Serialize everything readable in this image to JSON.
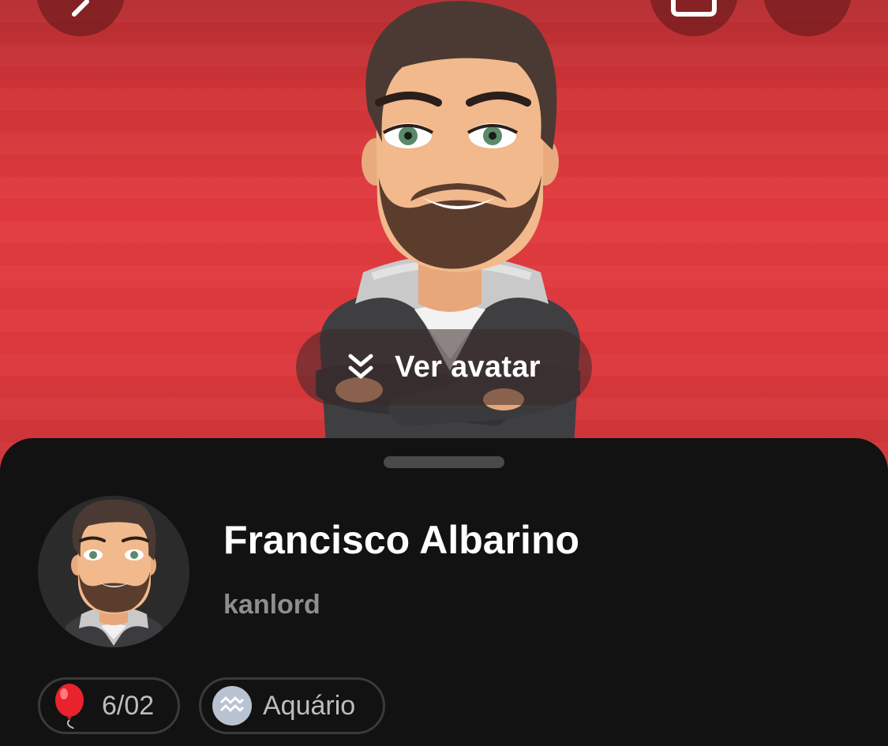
{
  "header": {
    "back_icon": "back-chevron-icon",
    "share_icon": "share-icon",
    "more_icon": "more-icon"
  },
  "hero": {
    "background_color": "#e23b3f",
    "view_avatar_label": "Ver avatar",
    "view_avatar_icon": "double-chevron-down-icon"
  },
  "profile": {
    "display_name": "Francisco Albarino",
    "username": "kanlord",
    "birthday": "6/02",
    "birthday_icon": "balloon-icon",
    "zodiac": "Aquário",
    "zodiac_icon": "aquarius-icon"
  },
  "colors": {
    "sheet_background": "#121212",
    "chip_border": "#3a3a3a",
    "username_text": "#8e8e8e"
  }
}
